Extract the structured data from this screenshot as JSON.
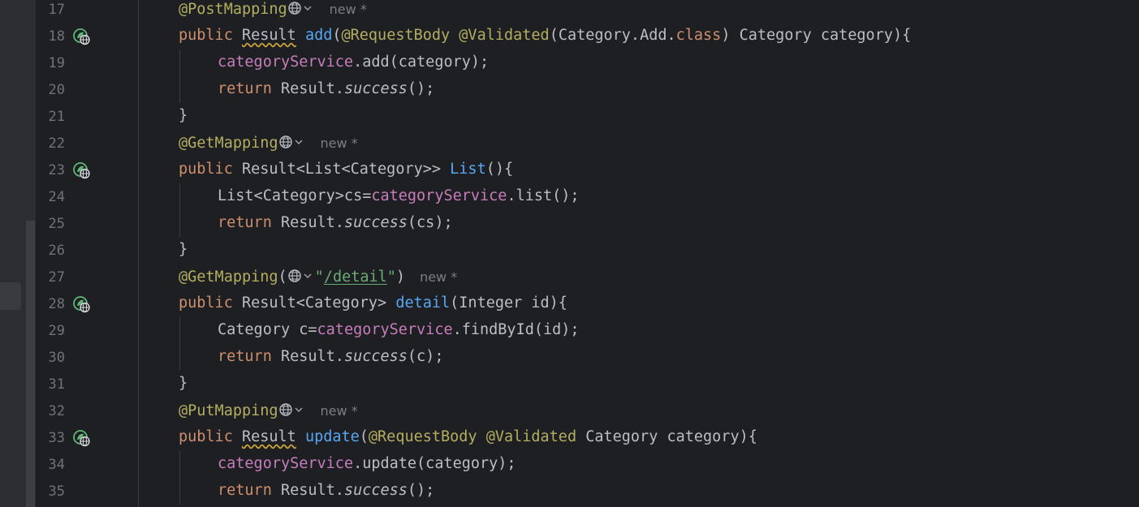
{
  "editor": {
    "inlay_hint": "new *",
    "lines": [
      {
        "num": "17",
        "indent": 1,
        "kind": "annotation",
        "tokens": [
          [
            "ann",
            "@PostMapping"
          ],
          [
            "globe",
            ""
          ]
        ],
        "hint": true
      },
      {
        "num": "18",
        "indent": 1,
        "kind": "endpoint",
        "tokens": [
          [
            "kw",
            "public "
          ],
          [
            "typo",
            "Result"
          ],
          [
            "",
            " "
          ],
          [
            "fn",
            "add"
          ],
          [
            "",
            "("
          ],
          [
            "ann",
            "@RequestBody"
          ],
          [
            "",
            " "
          ],
          [
            "ann",
            "@Validated"
          ],
          [
            "",
            "(Category.Add."
          ],
          [
            "kw",
            "class"
          ],
          [
            "",
            ") Category category){"
          ]
        ]
      },
      {
        "num": "19",
        "indent": 2,
        "tokens": [
          [
            "fld",
            "categoryService"
          ],
          [
            "",
            ".add(category);"
          ]
        ]
      },
      {
        "num": "20",
        "indent": 2,
        "tokens": [
          [
            "kw",
            "return "
          ],
          [
            "",
            "Result."
          ],
          [
            "it",
            "success"
          ],
          [
            "",
            "();"
          ]
        ]
      },
      {
        "num": "21",
        "indent": 1,
        "tokens": [
          [
            "",
            "}"
          ]
        ]
      },
      {
        "num": "22",
        "indent": 1,
        "kind": "annotation",
        "tokens": [
          [
            "ann",
            "@GetMapping"
          ],
          [
            "globe",
            ""
          ]
        ],
        "hint": true
      },
      {
        "num": "23",
        "indent": 1,
        "kind": "endpoint",
        "tokens": [
          [
            "kw",
            "public "
          ],
          [
            "",
            "Result<List<Category>> "
          ],
          [
            "fn",
            "List"
          ],
          [
            "",
            "(){"
          ]
        ]
      },
      {
        "num": "24",
        "indent": 2,
        "tokens": [
          [
            "",
            "List<Category>cs="
          ],
          [
            "fld",
            "categoryService"
          ],
          [
            "",
            ".list();"
          ]
        ]
      },
      {
        "num": "25",
        "indent": 2,
        "tokens": [
          [
            "kw",
            "return "
          ],
          [
            "",
            "Result."
          ],
          [
            "it",
            "success"
          ],
          [
            "",
            "(cs);"
          ]
        ]
      },
      {
        "num": "26",
        "indent": 1,
        "tokens": [
          [
            "",
            "}"
          ]
        ]
      },
      {
        "num": "27",
        "indent": 1,
        "kind": "annotation",
        "tokens": [
          [
            "ann",
            "@GetMapping"
          ],
          [
            "",
            "("
          ],
          [
            "globe",
            ""
          ],
          [
            "str",
            "\""
          ],
          [
            "strurl",
            "/detail"
          ],
          [
            "str",
            "\""
          ],
          [
            "",
            ")"
          ]
        ],
        "hint": true
      },
      {
        "num": "28",
        "indent": 1,
        "kind": "endpoint",
        "tokens": [
          [
            "kw",
            "public "
          ],
          [
            "",
            "Result<Category> "
          ],
          [
            "fn",
            "detail"
          ],
          [
            "",
            "(Integer id){"
          ]
        ]
      },
      {
        "num": "29",
        "indent": 2,
        "tokens": [
          [
            "",
            "Category c="
          ],
          [
            "fld",
            "categoryService"
          ],
          [
            "",
            ".findById(id);"
          ]
        ]
      },
      {
        "num": "30",
        "indent": 2,
        "tokens": [
          [
            "kw",
            "return "
          ],
          [
            "",
            "Result."
          ],
          [
            "it",
            "success"
          ],
          [
            "",
            "(c);"
          ]
        ]
      },
      {
        "num": "31",
        "indent": 1,
        "tokens": [
          [
            "",
            "}"
          ]
        ]
      },
      {
        "num": "32",
        "indent": 1,
        "kind": "annotation",
        "tokens": [
          [
            "ann",
            "@PutMapping"
          ],
          [
            "globe",
            ""
          ]
        ],
        "hint": true
      },
      {
        "num": "33",
        "indent": 1,
        "kind": "endpoint",
        "tokens": [
          [
            "kw",
            "public "
          ],
          [
            "typo",
            "Result"
          ],
          [
            "",
            " "
          ],
          [
            "fn",
            "update"
          ],
          [
            "",
            "("
          ],
          [
            "ann",
            "@RequestBody"
          ],
          [
            "",
            " "
          ],
          [
            "ann",
            "@Validated"
          ],
          [
            "",
            " Category category){"
          ]
        ]
      },
      {
        "num": "34",
        "indent": 2,
        "tokens": [
          [
            "fld",
            "categoryService"
          ],
          [
            "",
            ".update(category);"
          ]
        ]
      },
      {
        "num": "35",
        "indent": 2,
        "tokens": [
          [
            "kw",
            "return "
          ],
          [
            "",
            "Result."
          ],
          [
            "it",
            "success"
          ],
          [
            "",
            "();"
          ]
        ]
      }
    ]
  },
  "colors": {
    "background": "#1e1f22",
    "keyword": "#cf8e6d",
    "annotation": "#b3ae60",
    "function": "#56a8f5",
    "field": "#c77dbb",
    "string": "#6aab73",
    "default_text": "#bcbec4",
    "line_number": "#6f737a"
  },
  "icons": {
    "gutter": "spring-endpoint-globe-icon",
    "inline": "globe-dropdown-icon"
  }
}
